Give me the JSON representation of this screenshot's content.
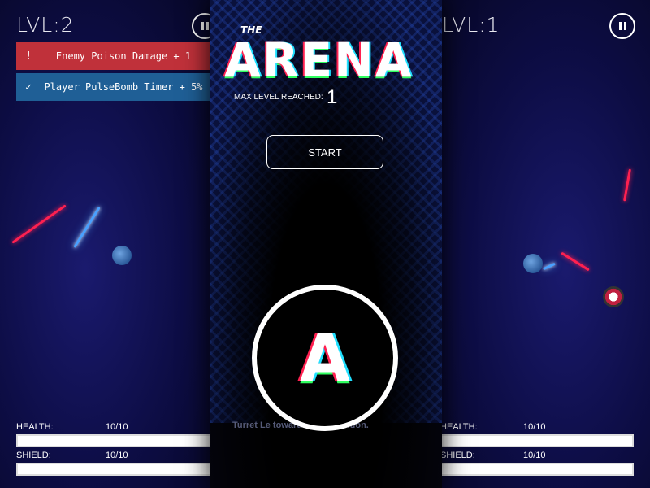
{
  "left": {
    "level": "LVL:2",
    "notifications": [
      {
        "icon": "!",
        "text": "Enemy Poison Damage + 1"
      },
      {
        "icon": "✓",
        "text": "Player PulseBomb Timer + 5%"
      }
    ],
    "health_label": "HEALTH:",
    "health_value": "10/10",
    "shield_label": "SHIELD:",
    "shield_value": "10/10"
  },
  "middle": {
    "title_small": "THE",
    "title": "ARENA",
    "max_level_label": "MAX LEVEL REACHED:",
    "max_level_value": "1",
    "start_label": "START",
    "logo_letter": "A",
    "hint_text": "Turret Le                            towards your position."
  },
  "right": {
    "level": "LVL:1",
    "health_label": "HEALTH:",
    "health_value": "10/10",
    "shield_label": "SHIELD:",
    "shield_value": "10/10"
  },
  "colors": {
    "notif_red": "#c0313a",
    "notif_blue": "#1f5f96",
    "laser_red": "#ff2050",
    "laser_blue": "#49a0ff"
  }
}
